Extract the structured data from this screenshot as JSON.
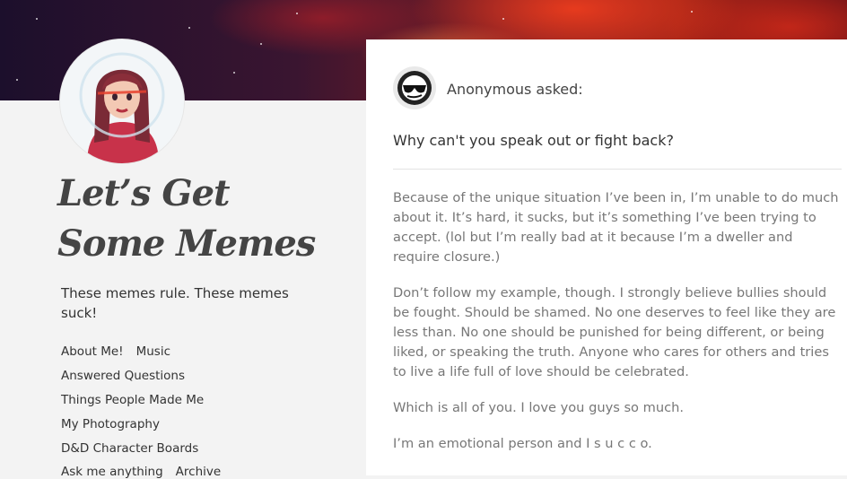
{
  "blog": {
    "title": "Let’s Get Some Memes",
    "description": "These memes rule. These memes suck!"
  },
  "nav": [
    [
      "About Me!",
      "Music"
    ],
    [
      "Answered Questions"
    ],
    [
      "Things People Made Me"
    ],
    [
      "My Photography"
    ],
    [
      "D&D Character Boards"
    ],
    [
      "Ask me anything",
      "Archive"
    ]
  ],
  "post": {
    "asker": "Anonymous asked:",
    "question": "Why can't you speak out or fight back?",
    "answer": [
      "Because of the unique situation I’ve been in, I’m unable to do much about it. It’s hard, it sucks, but it’s something I’ve been trying to accept. (lol but I’m really bad at it because I’m a dweller and require closure.)",
      "Don’t follow my example, though. I strongly believe bullies should be fought. Should be shamed. No one deserves to feel like they are less than. No one should be punished for being different, or being liked, or speaking the truth. Anyone who cares for others and tries to live a life full of love should be celebrated.",
      "Which is all of you. I love you guys so much.",
      "I’m an emotional person and I s u c c o."
    ]
  },
  "colors": {
    "sidebar_bg": "#f3f3f3",
    "post_bg": "#ffffff",
    "title": "#444444",
    "body_text": "#777777"
  },
  "icons": {
    "asker_avatar": "anonymous-sunglasses-icon",
    "blog_avatar": "astronaut-girl-avatar"
  }
}
